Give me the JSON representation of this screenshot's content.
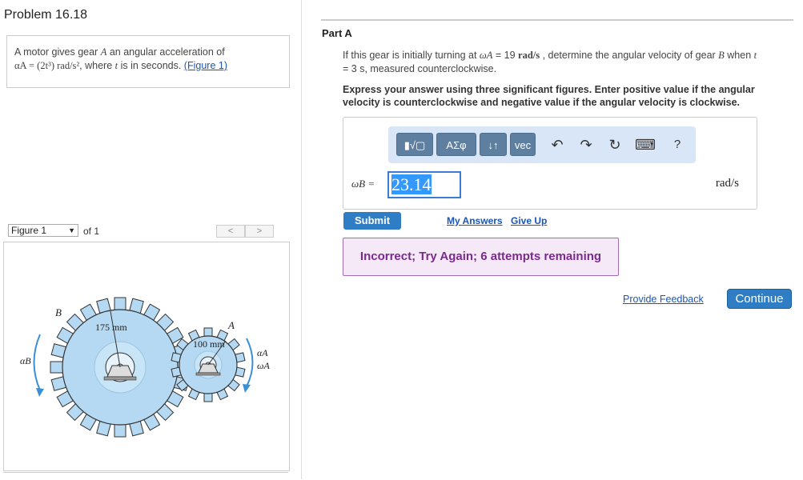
{
  "problem": {
    "title": "Problem 16.18",
    "text_1": "A motor gives gear ",
    "gear_a": "A",
    "text_2": " an angular acceleration of",
    "formula": "αA = (2t³) rad/s²",
    "text_3": ", where ",
    "t_var": "t",
    "text_4": " is in seconds. ",
    "figure_link": "(Figure 1)"
  },
  "figure_nav": {
    "select_value": "Figure 1",
    "of_text": "of 1",
    "prev_label": "<",
    "next_label": ">"
  },
  "figure": {
    "label_b": "B",
    "label_a": "A",
    "radius_b": "175 mm",
    "radius_a": "100 mm",
    "alpha_b": "αB",
    "alpha_a": "αA",
    "omega_a": "ωA"
  },
  "part": {
    "title": "Part A",
    "q1": "If this gear is initially turning at ",
    "omega_expr": "ωA",
    "q2": " = 19 ",
    "q_unit": "rad/s",
    "q3": " , determine the angular velocity of gear ",
    "q_gear": "B",
    "q4": " when ",
    "q_t": "t",
    "q5": " = 3 s, measured counterclockwise.",
    "instruction": "Express your answer using three significant figures. Enter positive value if the angular velocity is counterclockwise and negative value if the angular velocity is clockwise."
  },
  "toolbar": {
    "templates": "▮√▢",
    "greek": "ΑΣφ",
    "updown": "↓↑",
    "vec": "vec",
    "undo_icon": "↶",
    "redo_icon": "↷",
    "reset_icon": "↻",
    "keyboard_icon": "⌨",
    "help": "?"
  },
  "answer": {
    "label": "ωB =",
    "value": "23.14",
    "unit": "rad/s"
  },
  "actions": {
    "submit": "Submit",
    "my_answers": "My Answers",
    "give_up": "Give Up"
  },
  "feedback": "Incorrect; Try Again; 6 attempts remaining",
  "footer": {
    "provide_feedback": "Provide Feedback",
    "continue": "Continue"
  },
  "colors": {
    "accent": "#2f7ec5",
    "feedback_bg": "#f6e9f7",
    "feedback_text": "#7a2a8c",
    "gear_fill": "#b5d9f2"
  }
}
